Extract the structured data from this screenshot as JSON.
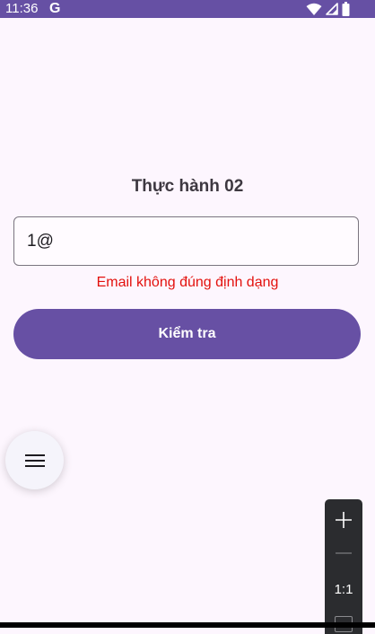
{
  "status_bar": {
    "time": "11:36",
    "google_glyph": "G",
    "color": "#6650a4",
    "icons": [
      "wifi-icon",
      "signal-icon",
      "battery-icon"
    ]
  },
  "page": {
    "title": "Thực hành 02"
  },
  "email_input": {
    "value": "1@"
  },
  "error": {
    "message": "Email không đúng định dạng",
    "color": "#e3110d"
  },
  "check_button": {
    "label": "Kiểm tra",
    "color": "#6750a4"
  },
  "fab": {
    "icon": "menu-icon"
  },
  "zoom_controls": {
    "zoom_in_icon": "plus-icon",
    "zoom_out_icon": "minus-icon",
    "ratio_label": "1:1",
    "fit_icon": "fit-screen-icon"
  }
}
